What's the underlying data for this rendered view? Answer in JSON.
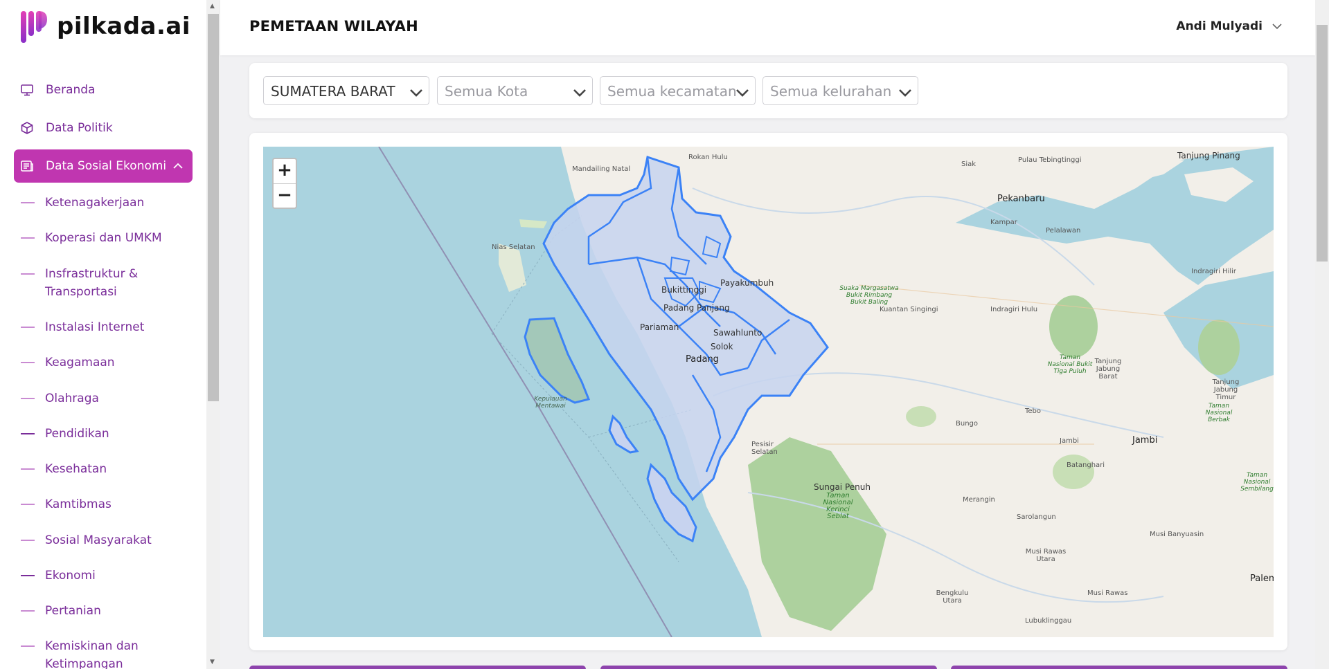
{
  "brand": {
    "name": "pilkada.ai"
  },
  "sidebar": {
    "items": [
      {
        "label": "Beranda",
        "icon": "monitor-icon"
      },
      {
        "label": "Data Politik",
        "icon": "cube-icon"
      },
      {
        "label": "Data Sosial Ekonomi",
        "icon": "newspaper-icon",
        "active": true,
        "expanded": true
      }
    ],
    "subitems": [
      "Ketenagakerjaan",
      "Koperasi dan UMKM",
      "Insfrastruktur & Transportasi",
      "Instalasi Internet",
      "Keagamaan",
      "Olahraga",
      "Pendidikan",
      "Kesehatan",
      "Kamtibmas",
      "Sosial Masyarakat",
      "Ekonomi",
      "Pertanian",
      "Kemiskinan dan Ketimpangan"
    ]
  },
  "header": {
    "title": "PEMETAAN WILAYAH",
    "user_name": "Andi Mulyadi"
  },
  "filters": {
    "province": "SUMATERA BARAT",
    "city_placeholder": "Semua Kota",
    "district_placeholder": "Semua kecamatan",
    "village_placeholder": "Semua kelurahan"
  },
  "map": {
    "zoom_in": "+",
    "zoom_out": "−",
    "labels": {
      "mandailing": "Mandailing Natal",
      "rokan": "Rokan Hulu",
      "siak": "Siak",
      "pekanbaru": "Pekanbaru",
      "tebingtinggi": "Pulau Tebingtinggi",
      "tanjungpinang": "Tanjung Pinang",
      "kampar": "Kampar",
      "pelalawan": "Pelalawan",
      "nias": "Nias Selatan",
      "indragiri_hilir": "Indragiri Hilir",
      "payakumbuh": "Payakumbuh",
      "bukittinggi": "Bukittinggi",
      "padangpanjang": "Padang Panjang",
      "pariaman": "Pariaman",
      "sawahlunto": "Sawahlunto",
      "solok": "Solok",
      "padang": "Padang",
      "kuantan": "Kuantan Singingi",
      "indragiri_hulu": "Indragiri Hulu",
      "suaka": "Suaka Margasatwa Bukit Rimbang Bukit Baling",
      "bukittigapuluh": "Taman Nasional Bukit Tiga Puluh",
      "tanjab_barat": "Tanjung Jabung Barat",
      "tanjab_timur": "Tanjung Jabung Timur",
      "berbak": "Taman Nasional Berbak",
      "mentawai": "Kepulauan Mentawai",
      "tebo": "Tebo",
      "bungo": "Bungo",
      "jambi_kab": "Jambi",
      "jambi": "Jambi",
      "batanghari": "Batanghari",
      "pesisir": "Pesisir Selatan",
      "sungaipenuh": "Sungai Penuh",
      "kerinci": "Taman Nasional Kerinci Seblat",
      "merangin": "Merangin",
      "sarolangun": "Sarolangun",
      "musibanyuasin": "Musi Banyuasin",
      "sembilang": "Taman Nasional Sembilang",
      "musirawas_utara": "Musi Rawas Utara",
      "musirawas": "Musi Rawas",
      "bengkulu_utara": "Bengkulu Utara",
      "lubuklinggau": "Lubuklinggau",
      "palembang": "Palem"
    }
  }
}
